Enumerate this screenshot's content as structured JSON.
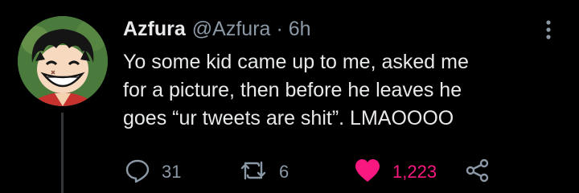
{
  "author": {
    "display_name": "Azfura",
    "handle": "@Azfura",
    "separator": "·",
    "time": "6h",
    "avatar_icon": "anime-character-avatar"
  },
  "tweet": {
    "text": "Yo some kid came up to me, asked me\nfor a picture, then before he leaves he\ngoes “ur tweets are shit”. LMAOOOO"
  },
  "actions": {
    "reply_count": "31",
    "retweet_count": "6",
    "like_count": "1,223",
    "liked": true
  },
  "icons": {
    "reply": "reply-icon",
    "retweet": "retweet-icon",
    "like": "heart-icon",
    "share": "share-icon",
    "more": "more-options-icon"
  },
  "colors": {
    "background": "#000000",
    "text_primary": "#e7e9ea",
    "text_secondary": "#8b98a5",
    "like_active": "#f91880",
    "thread_line": "#333639"
  }
}
